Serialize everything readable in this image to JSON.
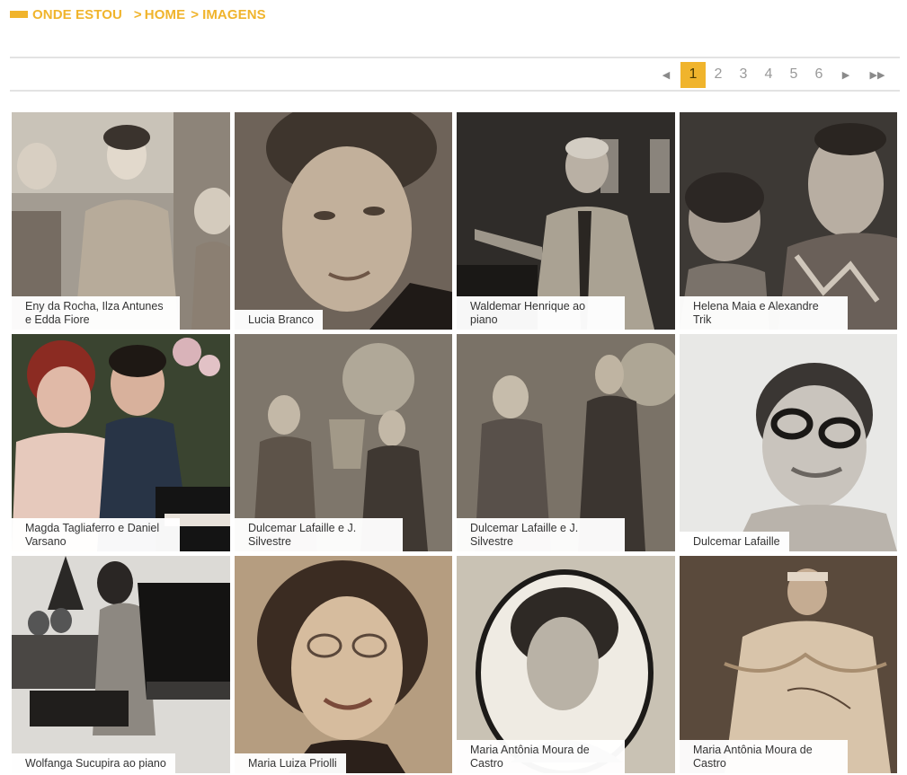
{
  "breadcrumb": {
    "title": "ONDE ESTOU",
    "sep1": ">",
    "home": "HOME",
    "sep2": ">",
    "current": "IMAGENS"
  },
  "pagination": {
    "prev": "◀",
    "pages": [
      "1",
      "2",
      "3",
      "4",
      "5",
      "6"
    ],
    "active_page": "1",
    "next": "▶",
    "last": "▶▶"
  },
  "gallery": [
    {
      "caption": "Eny da Rocha, Ilza Antunes e Edda Fiore"
    },
    {
      "caption": "Lucia Branco"
    },
    {
      "caption": "Waldemar Henrique ao piano"
    },
    {
      "caption": "Helena Maia e Alexandre Trik"
    },
    {
      "caption": "Magda Tagliaferro e Daniel Varsano"
    },
    {
      "caption": "Dulcemar Lafaille e J. Silvestre"
    },
    {
      "caption": "Dulcemar Lafaille e J. Silvestre"
    },
    {
      "caption": "Dulcemar Lafaille"
    },
    {
      "caption": "Wolfanga Sucupira ao piano"
    },
    {
      "caption": "Maria Luiza Priolli"
    },
    {
      "caption": "Maria Antônia Moura de Castro"
    },
    {
      "caption": "Maria Antônia Moura de Castro"
    }
  ],
  "colors": {
    "accent": "#f0b42c",
    "divider": "#e3e3e3",
    "caption_text": "#333333",
    "pager_text": "#9a9a9a"
  }
}
